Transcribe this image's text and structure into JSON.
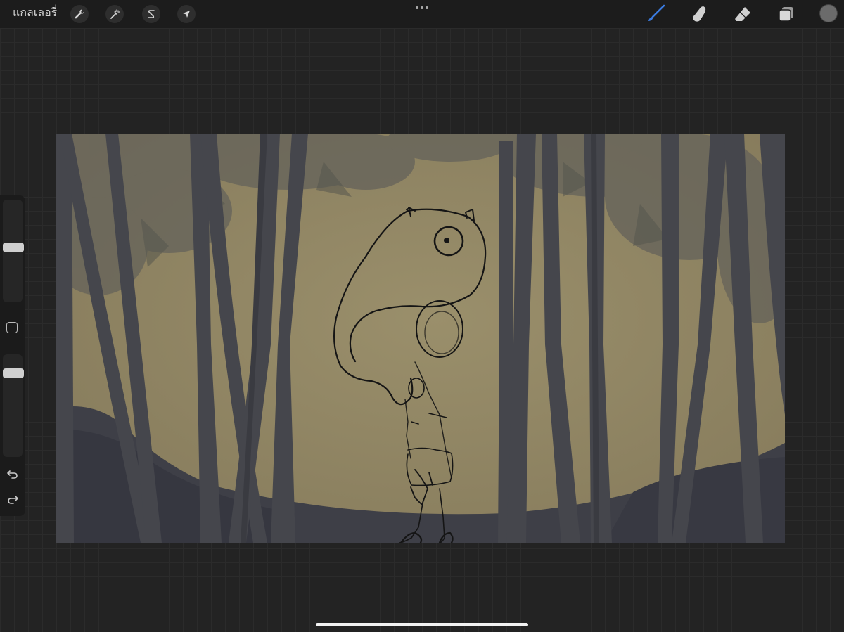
{
  "app": {
    "gallery_label": "แกลเลอรี่"
  },
  "toolbar_left": {
    "tools": [
      {
        "name": "actions",
        "icon": "wrench-icon"
      },
      {
        "name": "adjustments",
        "icon": "magic-wand-icon"
      },
      {
        "name": "selection",
        "icon": "selection-s-icon"
      },
      {
        "name": "transform",
        "icon": "arrow-cursor-icon"
      }
    ]
  },
  "toolbar_right": {
    "tools": [
      {
        "name": "brush",
        "icon": "paintbrush-icon",
        "active": true
      },
      {
        "name": "smudge",
        "icon": "smudge-finger-icon",
        "active": false
      },
      {
        "name": "eraser",
        "icon": "eraser-icon",
        "active": false
      },
      {
        "name": "layers",
        "icon": "layers-icon",
        "active": false
      }
    ],
    "current_color": "#6b6b6b"
  },
  "more_menu_icon": "ellipsis-icon",
  "sidebar": {
    "brush_size": 0.54,
    "opacity": 0.85,
    "modify_icon": "square-icon",
    "undo_icon": "undo-icon",
    "redo_icon": "redo-icon"
  },
  "colors": {
    "accent": "#3a7be0",
    "canvas_background": "#8e8362",
    "tree_color": "#44454b",
    "sketch_stroke": "#151515"
  }
}
